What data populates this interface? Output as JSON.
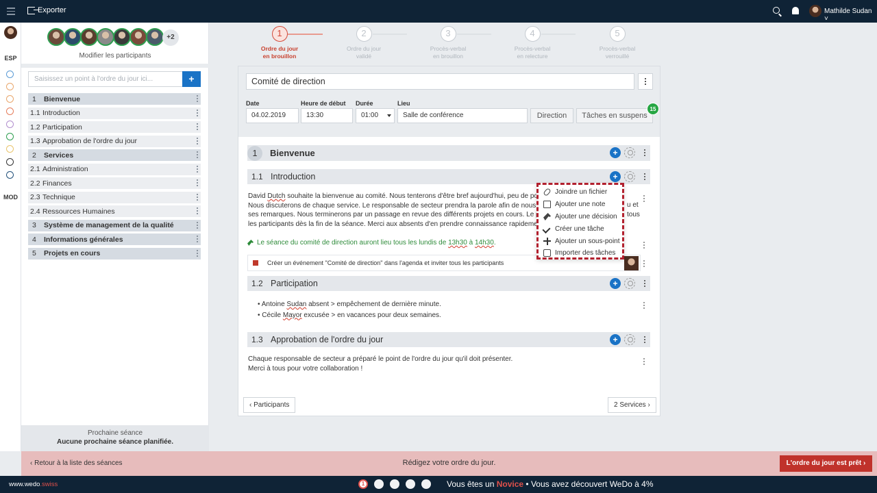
{
  "topbar": {
    "exporter": "Exporter",
    "user_name": "Mathilde Sudan"
  },
  "rail": {
    "esp": "ESP",
    "mod": "MOD",
    "dot_colors": [
      "#5b9bd5",
      "#e9a66b",
      "#e9a66b",
      "#e57d5b",
      "#b28fce",
      "#2e9e50",
      "#e9c46b",
      "#333333",
      "#1f4e79"
    ]
  },
  "sidebar": {
    "more_participants": "+2",
    "edit_participants": "Modifier les participants",
    "input_placeholder": "Saisissez un point à l'ordre du jour ici...",
    "add_label": "+",
    "agenda": [
      {
        "num": "1",
        "label": "Bienvenue",
        "main": true
      },
      {
        "num": "1.1",
        "label": "Introduction",
        "main": false
      },
      {
        "num": "1.2",
        "label": "Participation",
        "main": false
      },
      {
        "num": "1.3",
        "label": "Approbation de l'ordre du jour",
        "main": false
      },
      {
        "num": "2",
        "label": "Services",
        "main": true
      },
      {
        "num": "2.1",
        "label": "Administration",
        "main": false
      },
      {
        "num": "2.2",
        "label": "Finances",
        "main": false
      },
      {
        "num": "2.3",
        "label": "Technique",
        "main": false
      },
      {
        "num": "2.4",
        "label": "Ressources Humaines",
        "main": false
      },
      {
        "num": "3",
        "label": "Système de management de la qualité",
        "main": true
      },
      {
        "num": "4",
        "label": "Informations générales",
        "main": true
      },
      {
        "num": "5",
        "label": "Projets en cours",
        "main": true
      }
    ],
    "next_meeting_title": "Prochaine séance",
    "next_meeting_value": "Aucune prochaine séance planifiée."
  },
  "stepper": [
    {
      "num": "1",
      "l1": "Ordre du jour",
      "l2": "en brouillon",
      "active": true
    },
    {
      "num": "2",
      "l1": "Ordre du jour",
      "l2": "validé",
      "active": false
    },
    {
      "num": "3",
      "l1": "Procès-verbal",
      "l2": "en brouillon",
      "active": false
    },
    {
      "num": "4",
      "l1": "Procès-verbal",
      "l2": "en relecture",
      "active": false
    },
    {
      "num": "5",
      "l1": "Procès-verbal",
      "l2": "verrouillé",
      "active": false
    }
  ],
  "meeting": {
    "title": "Comité de direction",
    "date_label": "Date",
    "date": "04.02.2019",
    "start_label": "Heure de début",
    "start": "13:30",
    "duration_label": "Durée",
    "duration": "01:00",
    "place_label": "Lieu",
    "place": "Salle de conférence",
    "direction_btn": "Direction",
    "pending_btn": "Tâches en suspens",
    "pending_count": "15"
  },
  "content": {
    "s1": {
      "num": "1",
      "title": "Bienvenue"
    },
    "s11": {
      "num": "1.1",
      "title": "Introduction"
    },
    "intro_text": [
      "David <u>Dutch</u> souhaite la bienvenue au comité. Nous tenterons d'être bref aujourd'hui, peu de points",
      "Nous discuterons de chaque service. Le responsable de secteur prendra la parole afin de nous",
      "ses remarques. Nous terminerons par un passage en revue des différents projets en cours. Le pr",
      "les participants dès la fin de la séance. Merci aux absents d'en prendre connaissance rapidement."
    ],
    "intro_right": [
      "u et",
      "tous"
    ],
    "decision": "Le séance du comité de direction auront lieu tous les lundis de 13h30 à 14h30.",
    "task": "Créer un événement \"Comité de direction\" dans l'agenda et inviter tous les participants",
    "s12": {
      "num": "1.2",
      "title": "Participation"
    },
    "participation": [
      "• Antoine Sudan absent > empêchement de dernière minute.",
      "• Cécile Mayor excusée > en vacances pour deux semaines."
    ],
    "s13": {
      "num": "1.3",
      "title": "Approbation de l'ordre du jour"
    },
    "approbation": [
      "Chaque responsable de secteur a préparé le point de l'ordre du jour qu'il doit présenter.",
      "Merci à tous pour votre collaboration !"
    ],
    "prev_btn": "‹ Participants",
    "next_btn": "2 Services ›"
  },
  "context_menu": [
    {
      "icon": "clip",
      "label": "Joindre un fichier"
    },
    {
      "icon": "note",
      "label": "Ajouter une note"
    },
    {
      "icon": "gavel",
      "label": "Ajouter une décision"
    },
    {
      "icon": "check",
      "label": "Créer une tâche"
    },
    {
      "icon": "plus",
      "label": "Ajouter un sous-point"
    },
    {
      "icon": "import",
      "label": "Importer des tâches"
    }
  ],
  "actionbar": {
    "back": "‹  Retour à la liste des séances",
    "message": "Rédigez votre ordre du jour.",
    "ready": "L'ordre du jour est prêt  ›"
  },
  "statusbar": {
    "brand": "www.wedo",
    "brand_suffix": ".swiss",
    "current_level": "1",
    "text_a": "Vous êtes un ",
    "level_name": "Novice",
    "text_b": " • Vous avez découvert WeDo à 4%"
  }
}
